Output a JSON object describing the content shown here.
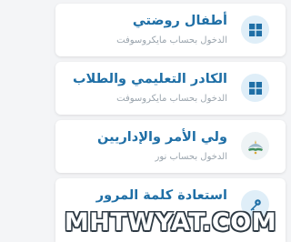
{
  "items": [
    {
      "title": "أطفال روضتي",
      "subtitle": "الدخول بحساب مايكروسوفت",
      "icon": "windows-logo-icon"
    },
    {
      "title": "الكادر التعليمي والطلاب",
      "subtitle": "الدخول بحساب مايكروسوفت",
      "icon": "windows-logo-icon"
    },
    {
      "title": "ولي الأمر والإداريين",
      "subtitle": "الدخول بحساب نور",
      "icon": "noor-logo-icon"
    },
    {
      "title": "استعادة كلمة المرور",
      "subtitle": "",
      "icon": "key-icon"
    }
  ],
  "watermark": "MHTWYAT.COM",
  "colors": {
    "title": "#1f6fa6",
    "subtitle": "#9aa4ad",
    "icon_blue": "#1f6fa6",
    "icon_bg": "#dfeef8"
  }
}
